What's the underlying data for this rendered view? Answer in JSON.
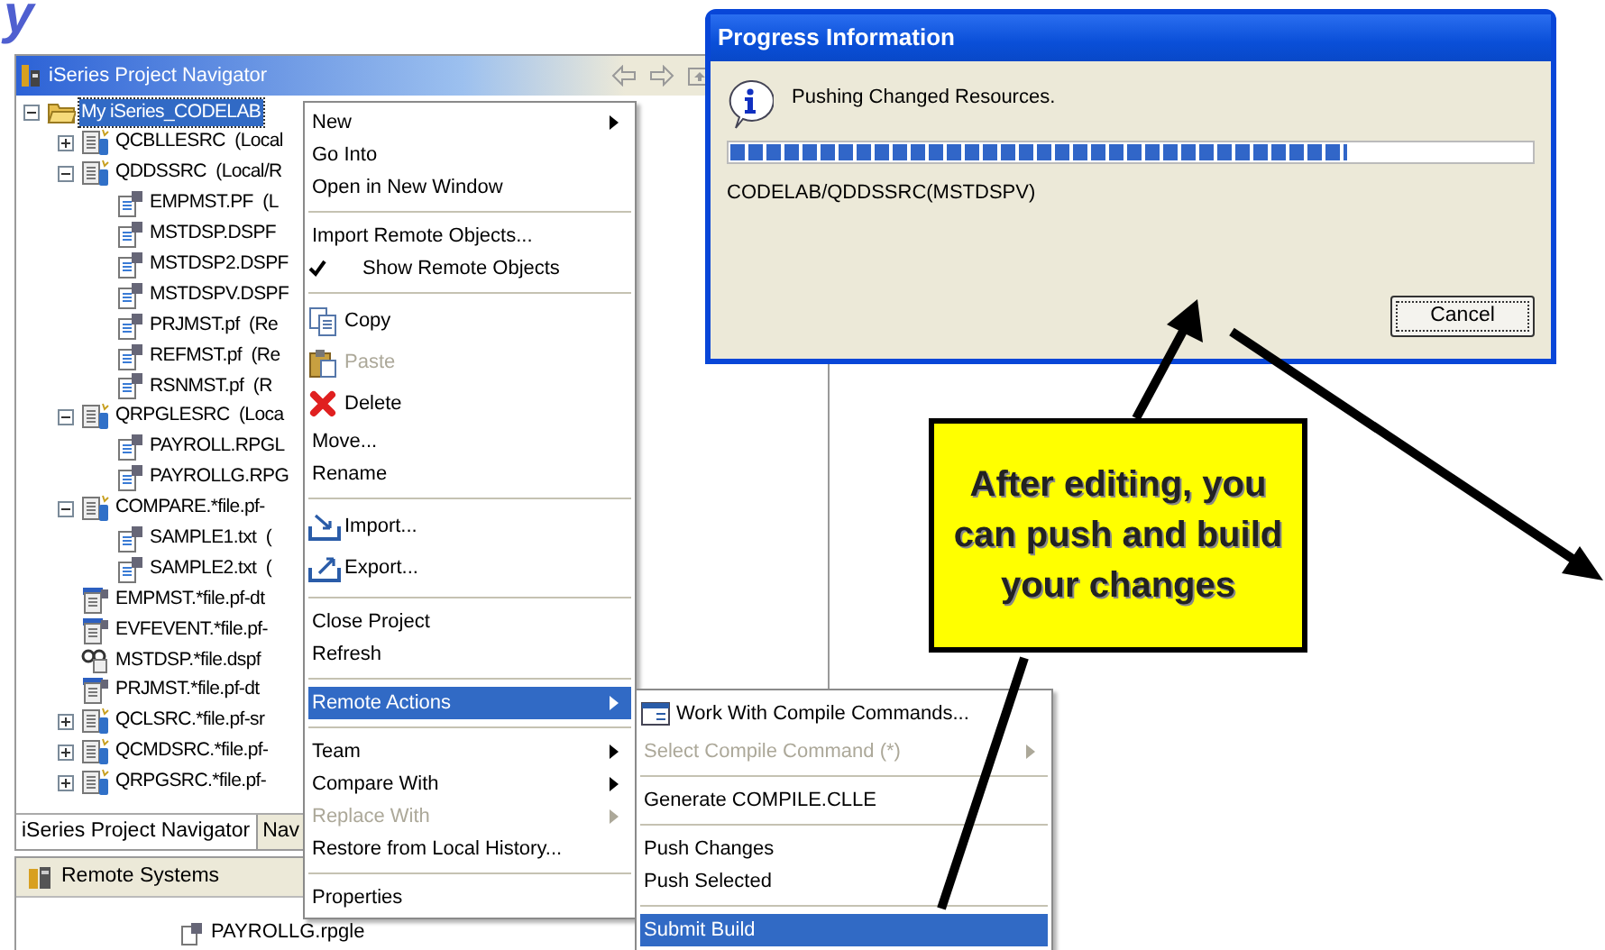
{
  "title_fragment": "y",
  "navigator": {
    "title": "iSeries Project Navigator",
    "tree": [
      {
        "kind": "project",
        "label": "My iSeries_CODELAB",
        "selected": true,
        "expanded": true,
        "children": [
          {
            "kind": "source_file",
            "label": "QCBLLESRC  (Local",
            "expanded": false
          },
          {
            "kind": "source_file",
            "label": "QDDSSRC  (Local/R",
            "expanded": true,
            "children": [
              {
                "kind": "member",
                "label": "EMPMST.PF  (L"
              },
              {
                "kind": "member",
                "label": "MSTDSP.DSPF"
              },
              {
                "kind": "member",
                "label": "MSTDSP2.DSPF"
              },
              {
                "kind": "member",
                "label": "MSTDSPV.DSPF"
              },
              {
                "kind": "member",
                "label": "PRJMST.pf  (Re"
              },
              {
                "kind": "member",
                "label": "REFMST.pf  (Re"
              },
              {
                "kind": "member",
                "label": "RSNMST.pf  (R"
              }
            ]
          },
          {
            "kind": "source_file",
            "label": "QRPGLESRC  (Loca",
            "expanded": true,
            "children": [
              {
                "kind": "member",
                "label": "PAYROLL.RPGL"
              },
              {
                "kind": "member",
                "label": "PAYROLLG.RPG"
              }
            ]
          },
          {
            "kind": "source_file",
            "label": "COMPARE.*file.pf-",
            "expanded": true,
            "children": [
              {
                "kind": "member",
                "label": "SAMPLE1.txt  ("
              },
              {
                "kind": "member",
                "label": "SAMPLE2.txt  ("
              }
            ]
          },
          {
            "kind": "data_file",
            "label": "EMPMST.*file.pf-dt"
          },
          {
            "kind": "data_file",
            "label": "EVFEVENT.*file.pf-"
          },
          {
            "kind": "display_file",
            "label": "MSTDSP.*file.dspf"
          },
          {
            "kind": "data_file",
            "label": "PRJMST.*file.pf-dt"
          },
          {
            "kind": "source_file",
            "label": "QCLSRC.*file.pf-sr",
            "expanded": false
          },
          {
            "kind": "source_file",
            "label": "QCMDSRC.*file.pf-",
            "expanded": false
          },
          {
            "kind": "source_file",
            "label": "QRPGSRC.*file.pf-",
            "expanded": false
          }
        ]
      }
    ],
    "tabs": [
      {
        "label": "iSeries Project Navigator",
        "selected": true
      },
      {
        "label": "Nav",
        "selected": false
      }
    ]
  },
  "remote_systems": {
    "title": "Remote Systems",
    "rows": [
      "PAYROLLG.rpgle"
    ]
  },
  "context_menu": [
    {
      "kind": "item",
      "label": "New",
      "submenu": true,
      "disabled": false,
      "checked": false,
      "selected": false
    },
    {
      "kind": "item",
      "label": "Go Into",
      "submenu": false,
      "disabled": false,
      "checked": false,
      "selected": false
    },
    {
      "kind": "item",
      "label": "Open in New Window",
      "submenu": false,
      "disabled": false,
      "checked": false,
      "selected": false
    },
    {
      "kind": "separator"
    },
    {
      "kind": "item",
      "label": "Import Remote Objects...",
      "submenu": false,
      "disabled": false,
      "checked": false,
      "selected": false
    },
    {
      "kind": "item",
      "label": "Show Remote Objects",
      "submenu": false,
      "disabled": false,
      "checked": true,
      "selected": false
    },
    {
      "kind": "separator"
    },
    {
      "kind": "icon_item",
      "label": "Copy",
      "submenu": false,
      "disabled": false,
      "checked": false,
      "selected": false
    },
    {
      "kind": "icon_item",
      "label": "Paste",
      "submenu": false,
      "disabled": true,
      "checked": false,
      "selected": false
    },
    {
      "kind": "icon_item",
      "label": "Delete",
      "submenu": false,
      "disabled": false,
      "checked": false,
      "selected": false
    },
    {
      "kind": "item",
      "label": "Move...",
      "submenu": false,
      "disabled": false,
      "checked": false,
      "selected": false
    },
    {
      "kind": "item",
      "label": "Rename",
      "submenu": false,
      "disabled": false,
      "checked": false,
      "selected": false
    },
    {
      "kind": "separator"
    },
    {
      "kind": "icon_item",
      "label": "Import...",
      "submenu": false,
      "disabled": false,
      "checked": false,
      "selected": false
    },
    {
      "kind": "icon_item",
      "label": "Export...",
      "submenu": false,
      "disabled": false,
      "checked": false,
      "selected": false
    },
    {
      "kind": "separator"
    },
    {
      "kind": "item",
      "label": "Close Project",
      "submenu": false,
      "disabled": false,
      "checked": false,
      "selected": false
    },
    {
      "kind": "item",
      "label": "Refresh",
      "submenu": false,
      "disabled": false,
      "checked": false,
      "selected": false
    },
    {
      "kind": "separator"
    },
    {
      "kind": "item",
      "label": "Remote Actions",
      "submenu": true,
      "disabled": false,
      "checked": false,
      "selected": true
    },
    {
      "kind": "separator"
    },
    {
      "kind": "item",
      "label": "Team",
      "submenu": true,
      "disabled": false,
      "checked": false,
      "selected": false
    },
    {
      "kind": "item",
      "label": "Compare With",
      "submenu": true,
      "disabled": false,
      "checked": false,
      "selected": false
    },
    {
      "kind": "item",
      "label": "Replace With",
      "submenu": true,
      "disabled": true,
      "checked": false,
      "selected": false
    },
    {
      "kind": "item",
      "label": "Restore from Local History...",
      "submenu": false,
      "disabled": false,
      "checked": false,
      "selected": false
    },
    {
      "kind": "separator"
    },
    {
      "kind": "item",
      "label": "Properties",
      "submenu": false,
      "disabled": false,
      "checked": false,
      "selected": false
    }
  ],
  "submenu": [
    {
      "kind": "icon_item",
      "label": "Work With Compile Commands...",
      "submenu": false,
      "disabled": false,
      "selected": false
    },
    {
      "kind": "item",
      "label": "Select Compile Command (*)",
      "submenu": true,
      "disabled": true,
      "selected": false
    },
    {
      "kind": "separator"
    },
    {
      "kind": "item",
      "label": "Generate COMPILE.CLLE",
      "submenu": false,
      "disabled": false,
      "selected": false
    },
    {
      "kind": "separator"
    },
    {
      "kind": "item",
      "label": "Push Changes",
      "submenu": false,
      "disabled": false,
      "selected": false
    },
    {
      "kind": "item",
      "label": "Push Selected",
      "submenu": false,
      "disabled": false,
      "selected": false
    },
    {
      "kind": "separator"
    },
    {
      "kind": "item",
      "label": "Submit Build",
      "submenu": false,
      "disabled": false,
      "selected": true
    }
  ],
  "progress_dialog": {
    "title": "Progress Information",
    "message": "Pushing Changed Resources.",
    "level": 0.77,
    "detail": "CODELAB/QDDSSRC(MSTDSPV)",
    "buttons": [
      "Cancel"
    ]
  },
  "callout": {
    "text": "After editing, you can push and build your changes"
  }
}
